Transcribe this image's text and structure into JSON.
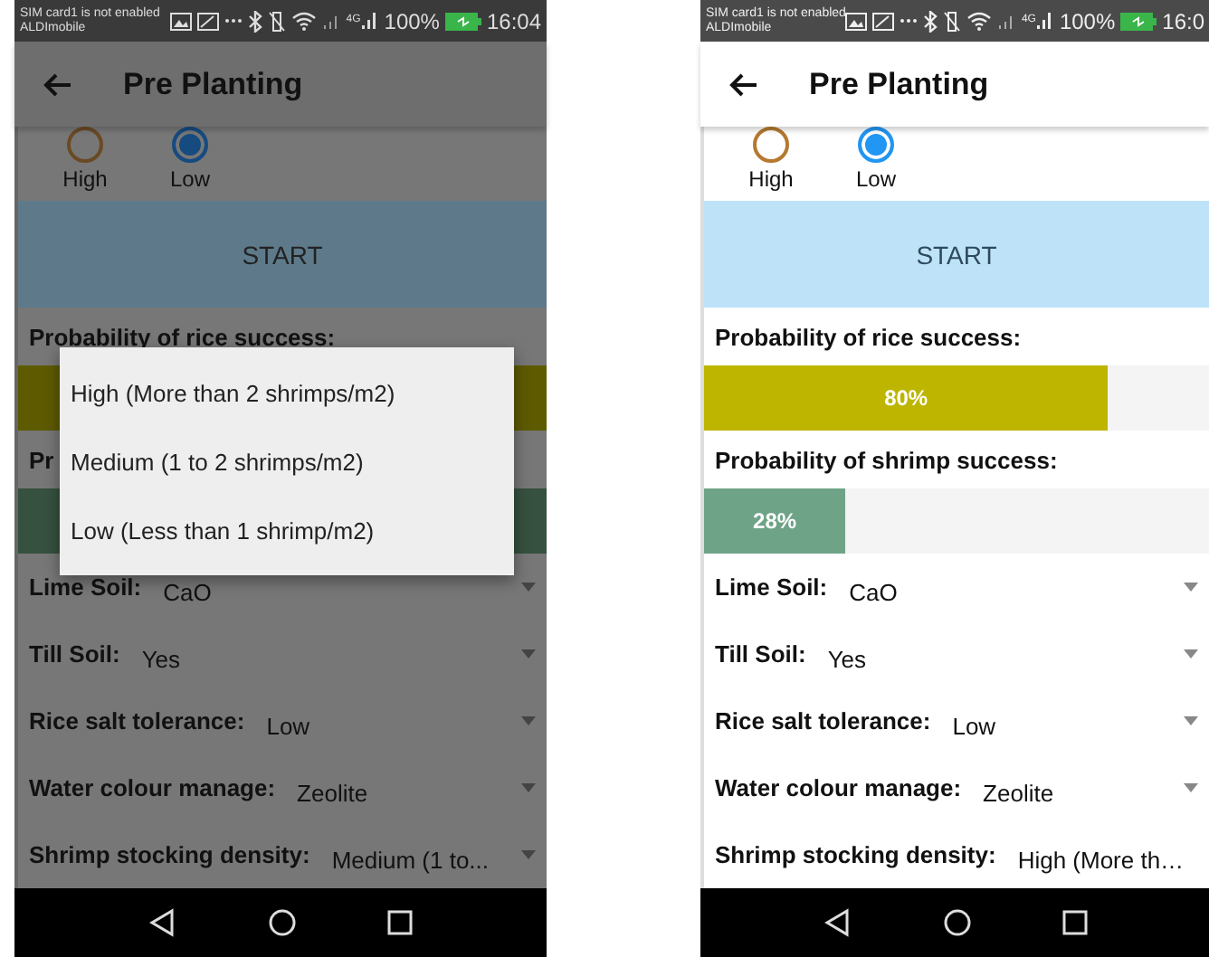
{
  "phones": [
    {
      "dimmed": true,
      "status_bar": {
        "carrier_note": "SIM card1 is not enabled",
        "carrier": "ALDImobile",
        "network": "4G",
        "battery": "100%",
        "time": "16:04"
      },
      "app_bar": {
        "title": "Pre Planting"
      },
      "radios": [
        {
          "label": "High",
          "selected": false
        },
        {
          "label": "Low",
          "selected": true
        }
      ],
      "start_button": "START",
      "results": [
        {
          "label": "Probability of rice success:",
          "color": "#5e5a00"
        },
        {
          "label": "Pr",
          "color": "#36513f"
        }
      ],
      "fields": [
        {
          "label": "Lime Soil:",
          "value": "CaO"
        },
        {
          "label": "Till Soil:",
          "value": "Yes"
        },
        {
          "label": "Rice salt tolerance:",
          "value": "Low"
        },
        {
          "label": "Water colour manage:",
          "value": "Zeolite"
        },
        {
          "label": "Shrimp stocking density:",
          "value": "Medium (1 to..."
        }
      ],
      "dialog": {
        "options": [
          "High (More than 2 shrimps/m2)",
          "Medium (1 to 2 shrimps/m2)",
          "Low (Less than 1 shrimp/m2)"
        ]
      }
    },
    {
      "dimmed": false,
      "status_bar": {
        "carrier_note": "SIM card1 is not enabled",
        "carrier": "ALDImobile",
        "network": "4G",
        "battery": "100%",
        "time": "16:0"
      },
      "app_bar": {
        "title": "Pre Planting"
      },
      "radios": [
        {
          "label": "High",
          "selected": false
        },
        {
          "label": "Low",
          "selected": true
        }
      ],
      "start_button": "START",
      "results": [
        {
          "label": "Probability of rice success:",
          "level": 0.8,
          "reading": "80%",
          "color": "#bdb500"
        },
        {
          "label": "Probability of shrimp success:",
          "level": 0.28,
          "reading": "28%",
          "color": "#6fa387"
        }
      ],
      "fields": [
        {
          "label": "Lime Soil:",
          "value": "CaO"
        },
        {
          "label": "Till Soil:",
          "value": "Yes"
        },
        {
          "label": "Rice salt tolerance:",
          "value": "Low"
        },
        {
          "label": "Water colour manage:",
          "value": "Zeolite"
        },
        {
          "label": "Shrimp stocking density:",
          "value": "High (More th…"
        }
      ]
    }
  ]
}
